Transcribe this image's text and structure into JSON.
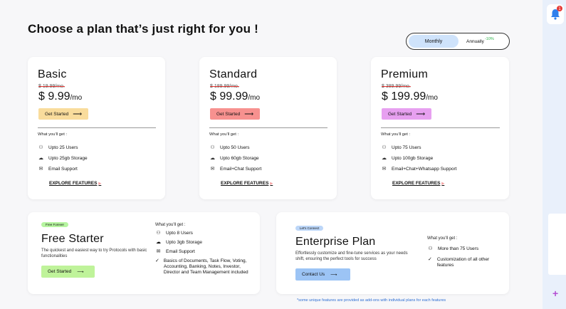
{
  "page_title": "Choose a plan that’s just right for you !",
  "billing_toggle": {
    "monthly": "Monthly",
    "annually": "Annually",
    "discount": "-10%"
  },
  "plans": [
    {
      "name": "Basic",
      "old_price": "$ 19.99/mo.",
      "price": "$ 9.99",
      "per": "/mo",
      "button": "Get Started",
      "button_color": "#f9dc9c",
      "what_you_get": "What you'll get :",
      "features": [
        {
          "icon": "user-icon",
          "glyph": "⚇",
          "text": "Upto 25 Users"
        },
        {
          "icon": "cloud-icon",
          "glyph": "☁",
          "text": "Upto 25gb Storage"
        },
        {
          "icon": "mail-icon",
          "glyph": "✉",
          "text": "Email Support"
        }
      ],
      "explore": "EXPLORE FEATURES"
    },
    {
      "name": "Standard",
      "old_price": "$ 189.99/mo.",
      "price": "$ 99.99",
      "per": "/mo",
      "button": "Get Started",
      "button_color": "#f7918f",
      "what_you_get": "What you'll get :",
      "features": [
        {
          "icon": "user-icon",
          "glyph": "⚇",
          "text": "Upto 50 Users"
        },
        {
          "icon": "cloud-icon",
          "glyph": "☁",
          "text": "Upto 60gb Storage"
        },
        {
          "icon": "mail-icon",
          "glyph": "✉",
          "text": "Email+Chat Support"
        }
      ],
      "explore": "EXPLORE FEATURES"
    },
    {
      "name": "Premium",
      "old_price": "$ 389.99/mo.",
      "price": "$ 199.99",
      "per": "/mo",
      "button": "Get Started",
      "button_color": "#e7a0f0",
      "what_you_get": "What you'll get :",
      "features": [
        {
          "icon": "user-icon",
          "glyph": "⚇",
          "text": "Upto 75 Users"
        },
        {
          "icon": "cloud-icon",
          "glyph": "☁",
          "text": "Upto 100gb Storage"
        },
        {
          "icon": "mail-icon",
          "glyph": "✉",
          "text": "Email+Chat+Whatsapp Support"
        }
      ],
      "explore": "EXPLORE FEATURES"
    }
  ],
  "free": {
    "tag": "Free Forever",
    "tag_color": "#b6f5a0",
    "name": "Free Starter",
    "desc": "The quickest and easiest way to try Protocols with basic functionalities",
    "button": "Get Started",
    "button_color": "#bff39a",
    "what_you_get": "What you'll get :",
    "features": [
      {
        "icon": "user-icon",
        "glyph": "⚇",
        "text": "Upto 8 Users"
      },
      {
        "icon": "cloud-icon",
        "glyph": "☁",
        "text": "Upto 3gb Storage"
      },
      {
        "icon": "mail-icon",
        "glyph": "✉",
        "text": "Email Support"
      },
      {
        "icon": "check-icon",
        "glyph": "✓",
        "text": "Basics of Documents, Task Flow, Voting, Accounting, Banking, Notes, Investor, Director and Team Management included"
      }
    ]
  },
  "enterprise": {
    "tag": "Let's Connect",
    "tag_color": "#bcd6f8",
    "name": "Enterprise Plan",
    "desc": "Effortlessly customize and fine-tune services as your needs shift, ensuring the perfect tools for success",
    "button": "Contact Us",
    "button_color": "#9cc4f5",
    "what_you_get": "What you'll get :",
    "features": [
      {
        "icon": "user-icon",
        "glyph": "⚇",
        "text": "More than 75 Users"
      },
      {
        "icon": "check-icon",
        "glyph": "✓",
        "text": "Customization of all other features"
      }
    ]
  },
  "footnote": "*some unique features are provided as add-ons with individual plans for each features",
  "notification_count": "1"
}
